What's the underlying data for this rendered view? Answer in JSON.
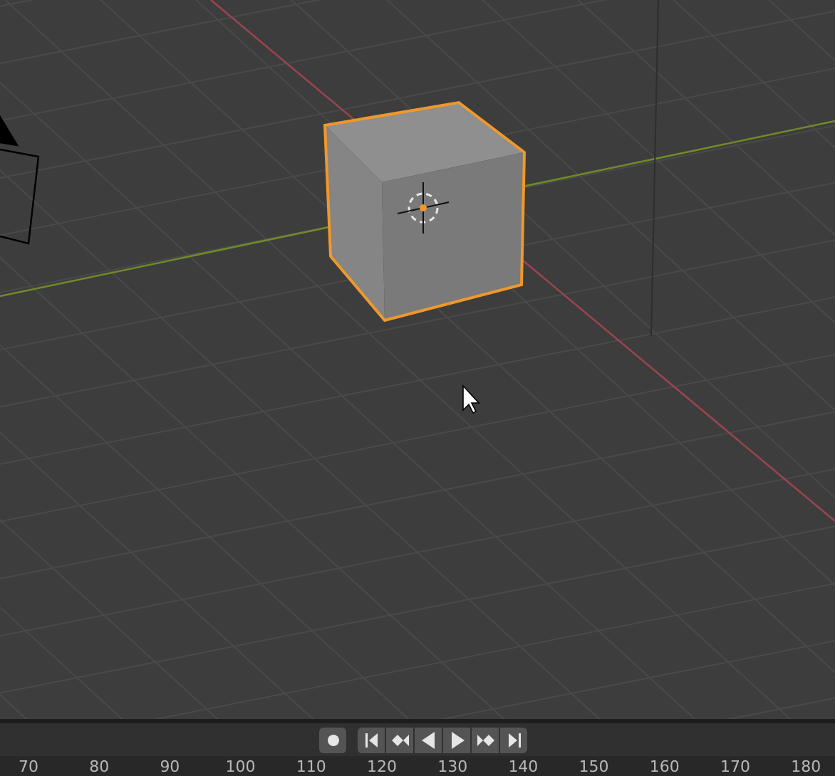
{
  "timeline": {
    "buttons": [
      {
        "kind": "record"
      },
      {
        "kind": "jump-start"
      },
      {
        "kind": "prev-key"
      },
      {
        "kind": "play-reverse"
      },
      {
        "kind": "play"
      },
      {
        "kind": "next-key"
      },
      {
        "kind": "jump-end"
      }
    ],
    "frame_ticks": [
      "70",
      "80",
      "90",
      "100",
      "110",
      "120",
      "130",
      "140",
      "150",
      "160",
      "170",
      "180"
    ]
  }
}
